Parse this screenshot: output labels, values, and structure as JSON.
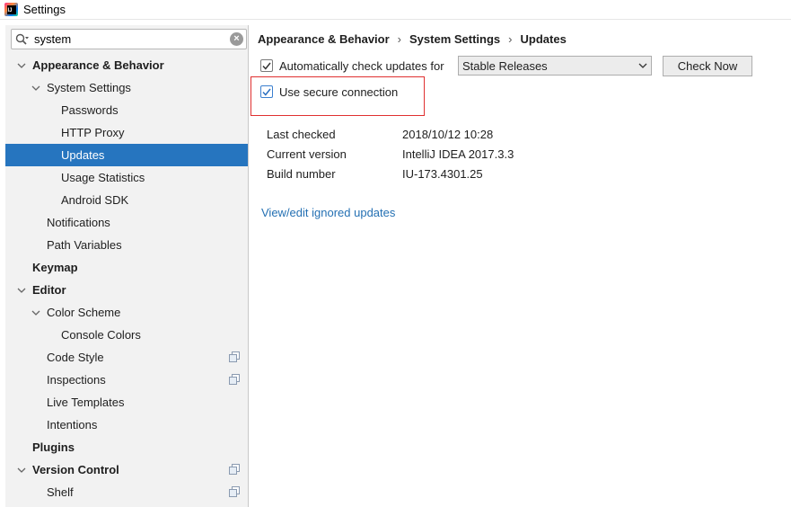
{
  "window": {
    "title": "Settings"
  },
  "search": {
    "value": "system"
  },
  "tree": [
    {
      "label": "Appearance & Behavior",
      "bold": true,
      "level": 0,
      "arrow": "down"
    },
    {
      "label": "System Settings",
      "bold": false,
      "level": 1,
      "arrow": "down"
    },
    {
      "label": "Passwords",
      "level": 2
    },
    {
      "label": "HTTP Proxy",
      "level": 2
    },
    {
      "label": "Updates",
      "level": 2,
      "selected": true
    },
    {
      "label": "Usage Statistics",
      "level": 2
    },
    {
      "label": "Android SDK",
      "level": 2
    },
    {
      "label": "Notifications",
      "level": 1
    },
    {
      "label": "Path Variables",
      "level": 1
    },
    {
      "label": "Keymap",
      "bold": true,
      "level": 0
    },
    {
      "label": "Editor",
      "bold": true,
      "level": 0,
      "arrow": "down"
    },
    {
      "label": "Color Scheme",
      "level": 1,
      "arrow": "down"
    },
    {
      "label": "Console Colors",
      "level": 2
    },
    {
      "label": "Code Style",
      "level": 1,
      "copy_icon": true
    },
    {
      "label": "Inspections",
      "level": 1,
      "copy_icon": true
    },
    {
      "label": "Live Templates",
      "level": 1
    },
    {
      "label": "Intentions",
      "level": 1
    },
    {
      "label": "Plugins",
      "bold": true,
      "level": 0
    },
    {
      "label": "Version Control",
      "bold": true,
      "level": 0,
      "arrow": "down",
      "copy_icon": true
    },
    {
      "label": "Shelf",
      "level": 1,
      "copy_icon": true
    }
  ],
  "breadcrumb": {
    "items": [
      "Appearance & Behavior",
      "System Settings",
      "Updates"
    ],
    "separator": "›"
  },
  "updates": {
    "auto_check_label": "Automatically check updates for",
    "auto_check_checked": true,
    "channel": "Stable Releases",
    "check_now_label": "Check Now",
    "secure_label": "Use secure connection",
    "secure_checked": true,
    "info": {
      "last_checked_label": "Last checked",
      "last_checked_value": "2018/10/12 10:28",
      "current_version_label": "Current version",
      "current_version_value": "IntelliJ IDEA 2017.3.3",
      "build_number_label": "Build number",
      "build_number_value": "IU-173.4301.25"
    },
    "ignored_link": "View/edit ignored updates"
  },
  "colors": {
    "selection": "#2675bf",
    "link": "#2470b3",
    "highlight_border": "#e03030",
    "sidebar_bg": "#f2f2f2"
  }
}
